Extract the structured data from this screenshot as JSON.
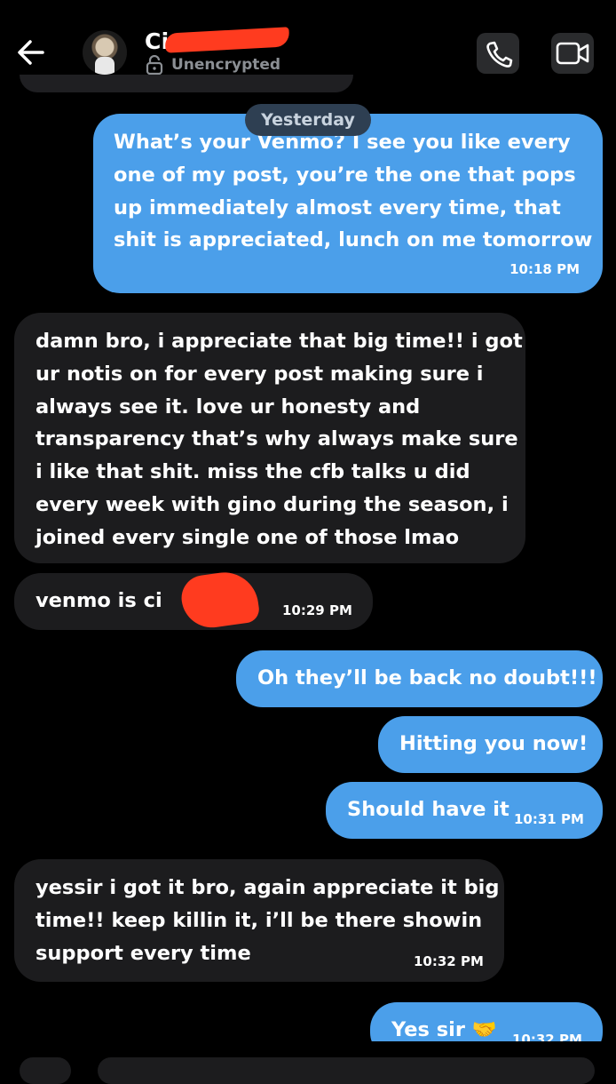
{
  "header": {
    "contact_name_visible": "Ci",
    "encryption_status": "Unencrypted",
    "icons": [
      "back-arrow-icon",
      "avatar",
      "lock-icon",
      "phone-icon",
      "video-icon"
    ]
  },
  "divider": {
    "label": "Yesterday"
  },
  "messages": [
    {
      "dir": "out",
      "text": "What’s your Venmo? I see you like every\none of my post, you’re the one that pops\nup immediately almost every time, that\nshit is appreciated, lunch on me tomorrow",
      "time": "10:18 PM"
    },
    {
      "dir": "in",
      "text": "damn bro, i appreciate that big time!! i got\nur notis on for every post making sure i\nalways see it. love ur honesty and\ntransparency that’s why always make sure\ni like that shit. miss the cfb talks u did\nevery week with gino during the season, i\njoined every single one of those lmao",
      "time": ""
    },
    {
      "dir": "in",
      "text": "venmo is ci",
      "time": "10:29 PM"
    },
    {
      "dir": "out",
      "text": "Oh they’ll be back no doubt!!!",
      "time": ""
    },
    {
      "dir": "out",
      "text": "Hitting you now!",
      "time": ""
    },
    {
      "dir": "out",
      "text": "Should have it",
      "time": "10:31 PM"
    },
    {
      "dir": "in",
      "text": "yessir i got it bro, again appreciate it big\ntime!! keep killin it, i’ll be there showin\nsupport every time",
      "time": "10:32 PM"
    },
    {
      "dir": "out",
      "text": "Yes sir 🤝",
      "time": "10:32 PM"
    }
  ],
  "colors": {
    "background": "#000000",
    "outgoing_bubble": "#4b9fea",
    "incoming_bubble": "#1c1c1e",
    "divider_bg": "#2e3f52",
    "redaction": "#ff3b1f"
  }
}
